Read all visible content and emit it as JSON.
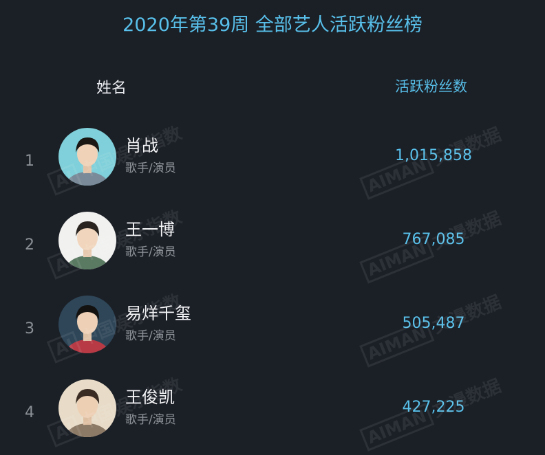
{
  "page": {
    "title": "2020年第39周 全部艺人活跃粉丝榜"
  },
  "table": {
    "headers": {
      "name": "姓名",
      "fans": "活跃粉丝数"
    },
    "rows": [
      {
        "rank": "1",
        "name": "肖战",
        "role": "歌手/演员",
        "fans": "1,015,858",
        "avatar_bg": "#7fd0da",
        "shirt": "#7a8a98"
      },
      {
        "rank": "2",
        "name": "王一博",
        "role": "歌手/演员",
        "fans": "767,085",
        "avatar_bg": "#f1f1ef",
        "shirt": "#5a7a62"
      },
      {
        "rank": "3",
        "name": "易烊千玺",
        "role": "歌手/演员",
        "fans": "505,487",
        "avatar_bg": "#2e4658",
        "shirt": "#b83a45"
      },
      {
        "rank": "4",
        "name": "王俊凯",
        "role": "歌手/演员",
        "fans": "427,225",
        "avatar_bg": "#e8dcc8",
        "shirt": "#8d7a66"
      }
    ]
  },
  "watermarks": {
    "left_text": "中国娱乐指数",
    "right_text": "文漫数据",
    "badge_left": "AI",
    "badge_right": "AIMAN"
  },
  "colors": {
    "background": "#1b1f26",
    "accent": "#58c0ea",
    "name_text": "#f2f3f5",
    "muted_text": "#8f949a"
  }
}
